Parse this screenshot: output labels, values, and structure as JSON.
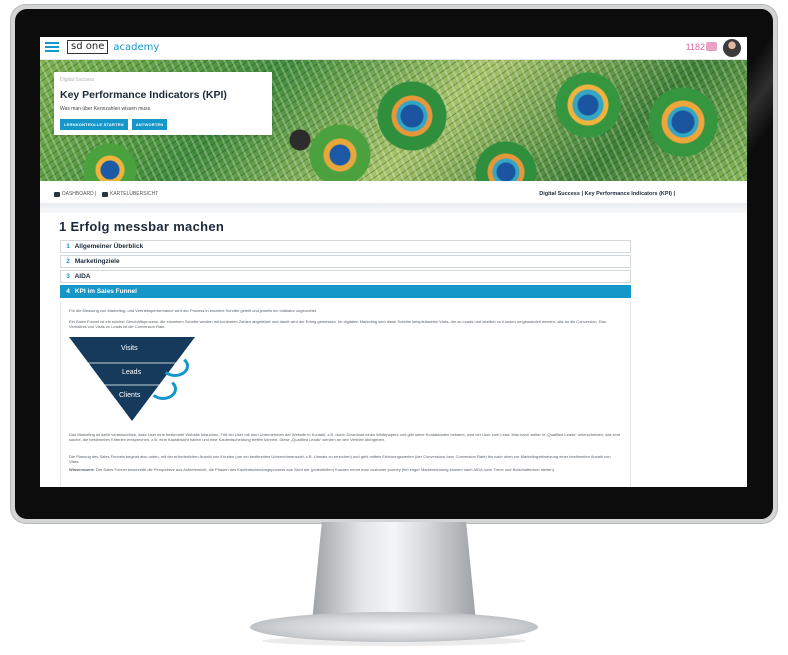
{
  "topbar": {
    "logo_box": "sd one",
    "logo_academy": "academy",
    "points": "1182"
  },
  "hero": {
    "kicker": "Digital Success",
    "title": "Key Performance Indicators (KPI)",
    "subtitle": "Was man über Kennzahlen wissen muss.",
    "buttons": [
      "LERNKONTROLLE STARTEN",
      "ANTWORTEN"
    ]
  },
  "breadcrumb": {
    "left": [
      "DASHBOARD |",
      "KARTELÜBERSICHT"
    ],
    "right": "Digital Success | Key Performance Indicators (KPI) |"
  },
  "content": {
    "section_title": "1 Erfolg messbar machen",
    "accordion": [
      {
        "num": "1",
        "label": "Allgemeiner Überblick",
        "active": false
      },
      {
        "num": "2",
        "label": "Marketingziele",
        "active": false
      },
      {
        "num": "3",
        "label": "AIDA",
        "active": false
      },
      {
        "num": "4",
        "label": "KPI im Sales Funnel",
        "active": true
      }
    ],
    "paragraphs": {
      "p1": "Für die Messung von Marketing- und Vertriebsperformance wird der Prozess in einzelne Schritte geteilt und jeweils ein Indikator zugeordnet.",
      "p2": "Ein Sales Funnel ist ein solcher Geschäftsprozess: die einzelnen Schritte werden mit konkreten Zahlen abgebildet und damit wird der Erfolg gemessen. Im digitalen Marketing sind diese Schritte beispielsweise Visits, die zu Leads und letztlich zu Kunden umgewandelt werden, das ist die Conversion. Das Verhältnis von Visits zu Leads ist die Conversion Rate.",
      "p3": "Das Marketing ist dafür verantwortlich, dass User eine bestimmte Website besuchen. Tritt ein User mit dem Unternehmen der Website in Kontakt, z.B. durch Download eines Whitepapers und gibt seine Kontaktdaten bekannt, wird der User zum Lead. Man kann weiter in „Qualified Leads“ unterscheiden, das sind solche, die bestimmten Kriterien entsprechen, z.B. eine Kaufabsicht haben und eine Kaufentscheidung treffen können. Diese „Qualified Leads“ werden an den Vertrieb übergeben.",
      "p4": "Die Planung des Sales Funnels beginnt also unten, mit der erforderlichen Anzahl von Kunden (um ein bestimmtes Unternehmensziel, z.B. Umsatz zu erreichen) und geht mittels Erfahrungswerten (der Conversions bzw. Conversion Rate) bis nach oben zur Marketingzielsetzung einer bestimmten Anzahl von Visits.",
      "p5_bold": "Wissenswert:",
      "p5": " Der Sales Funnel beschreibt die Perspektive aus Anbietersicht, die Phasen des Kaufentscheidungsprozess aus Sicht der (potentiellen) Kunden nennt man customer journey (bei enger Markenbindung können nach AIDA noch Treue und Botschaftertum stehen)."
    },
    "funnel": {
      "levels": [
        "Visits",
        "Leads",
        "Clients"
      ]
    }
  },
  "colors": {
    "accent": "#1597c9",
    "navy": "#1b2a3a",
    "funnel": "#163a5c",
    "points": "#d9679d"
  },
  "icons": [
    "menu-icon",
    "points-icon",
    "avatar",
    "dashboard-icon",
    "grid-icon"
  ]
}
